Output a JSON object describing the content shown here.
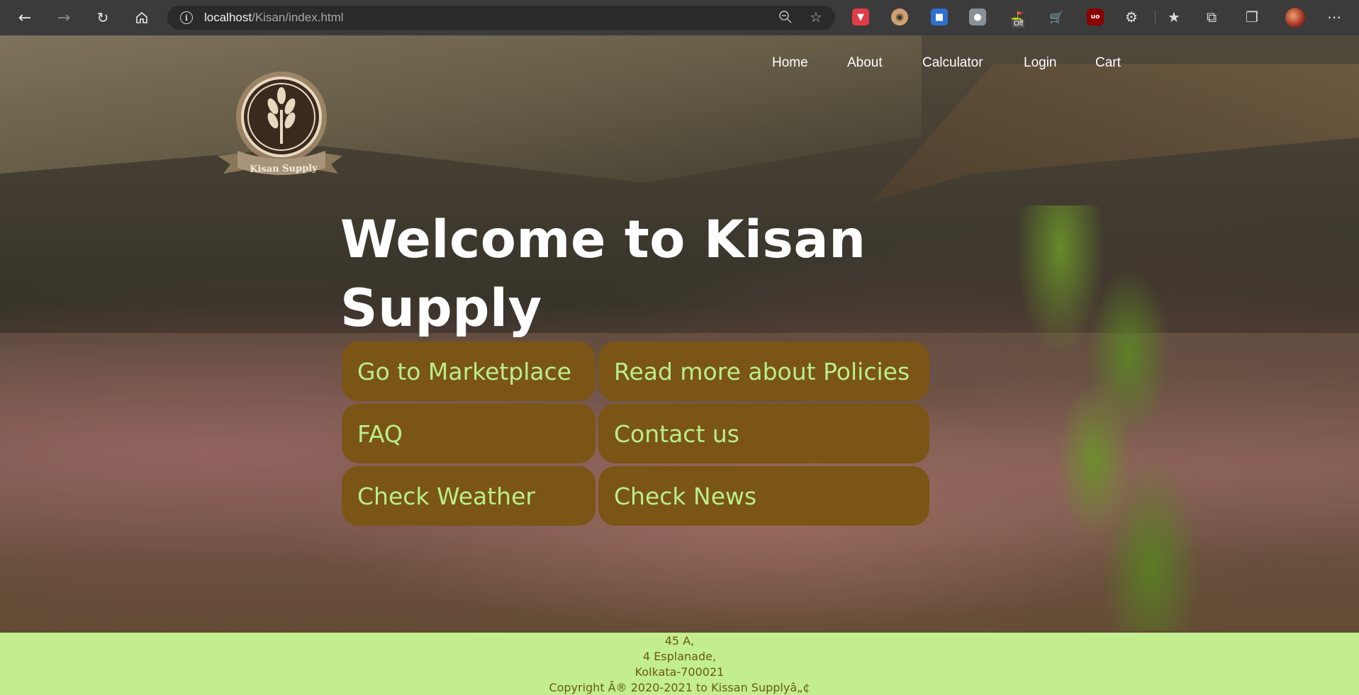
{
  "browser": {
    "url_host": "localhost",
    "url_path": "/Kisan/index.html",
    "extension_badge_text": "Off",
    "adblock_label": "uo"
  },
  "logo": {
    "text": "Kisan Supply"
  },
  "nav": {
    "items": [
      {
        "label": "Home"
      },
      {
        "label": "About"
      },
      {
        "label": "Calculator"
      },
      {
        "label": "Login"
      },
      {
        "label": "Cart"
      }
    ]
  },
  "hero": {
    "title_line1": "Welcome to Kisan",
    "title_line2": "Supply"
  },
  "actions": {
    "marketplace": "Go to Marketplace",
    "policies": "Read more about Policies",
    "faq": "FAQ",
    "contact": "Contact us",
    "weather": "Check Weather",
    "news": "Check News"
  },
  "footer": {
    "line1": "45 A,",
    "line2": "4 Esplanade,",
    "line3": "Kolkata-700021",
    "line4": "Copyright Â® 2020-2021 to Kissan Supplyâ„¢"
  },
  "colors": {
    "button_bg": "#7a5515",
    "button_text": "#b9ee8a",
    "footer_bg": "#c2ee90",
    "footer_text": "#6a5a10"
  }
}
